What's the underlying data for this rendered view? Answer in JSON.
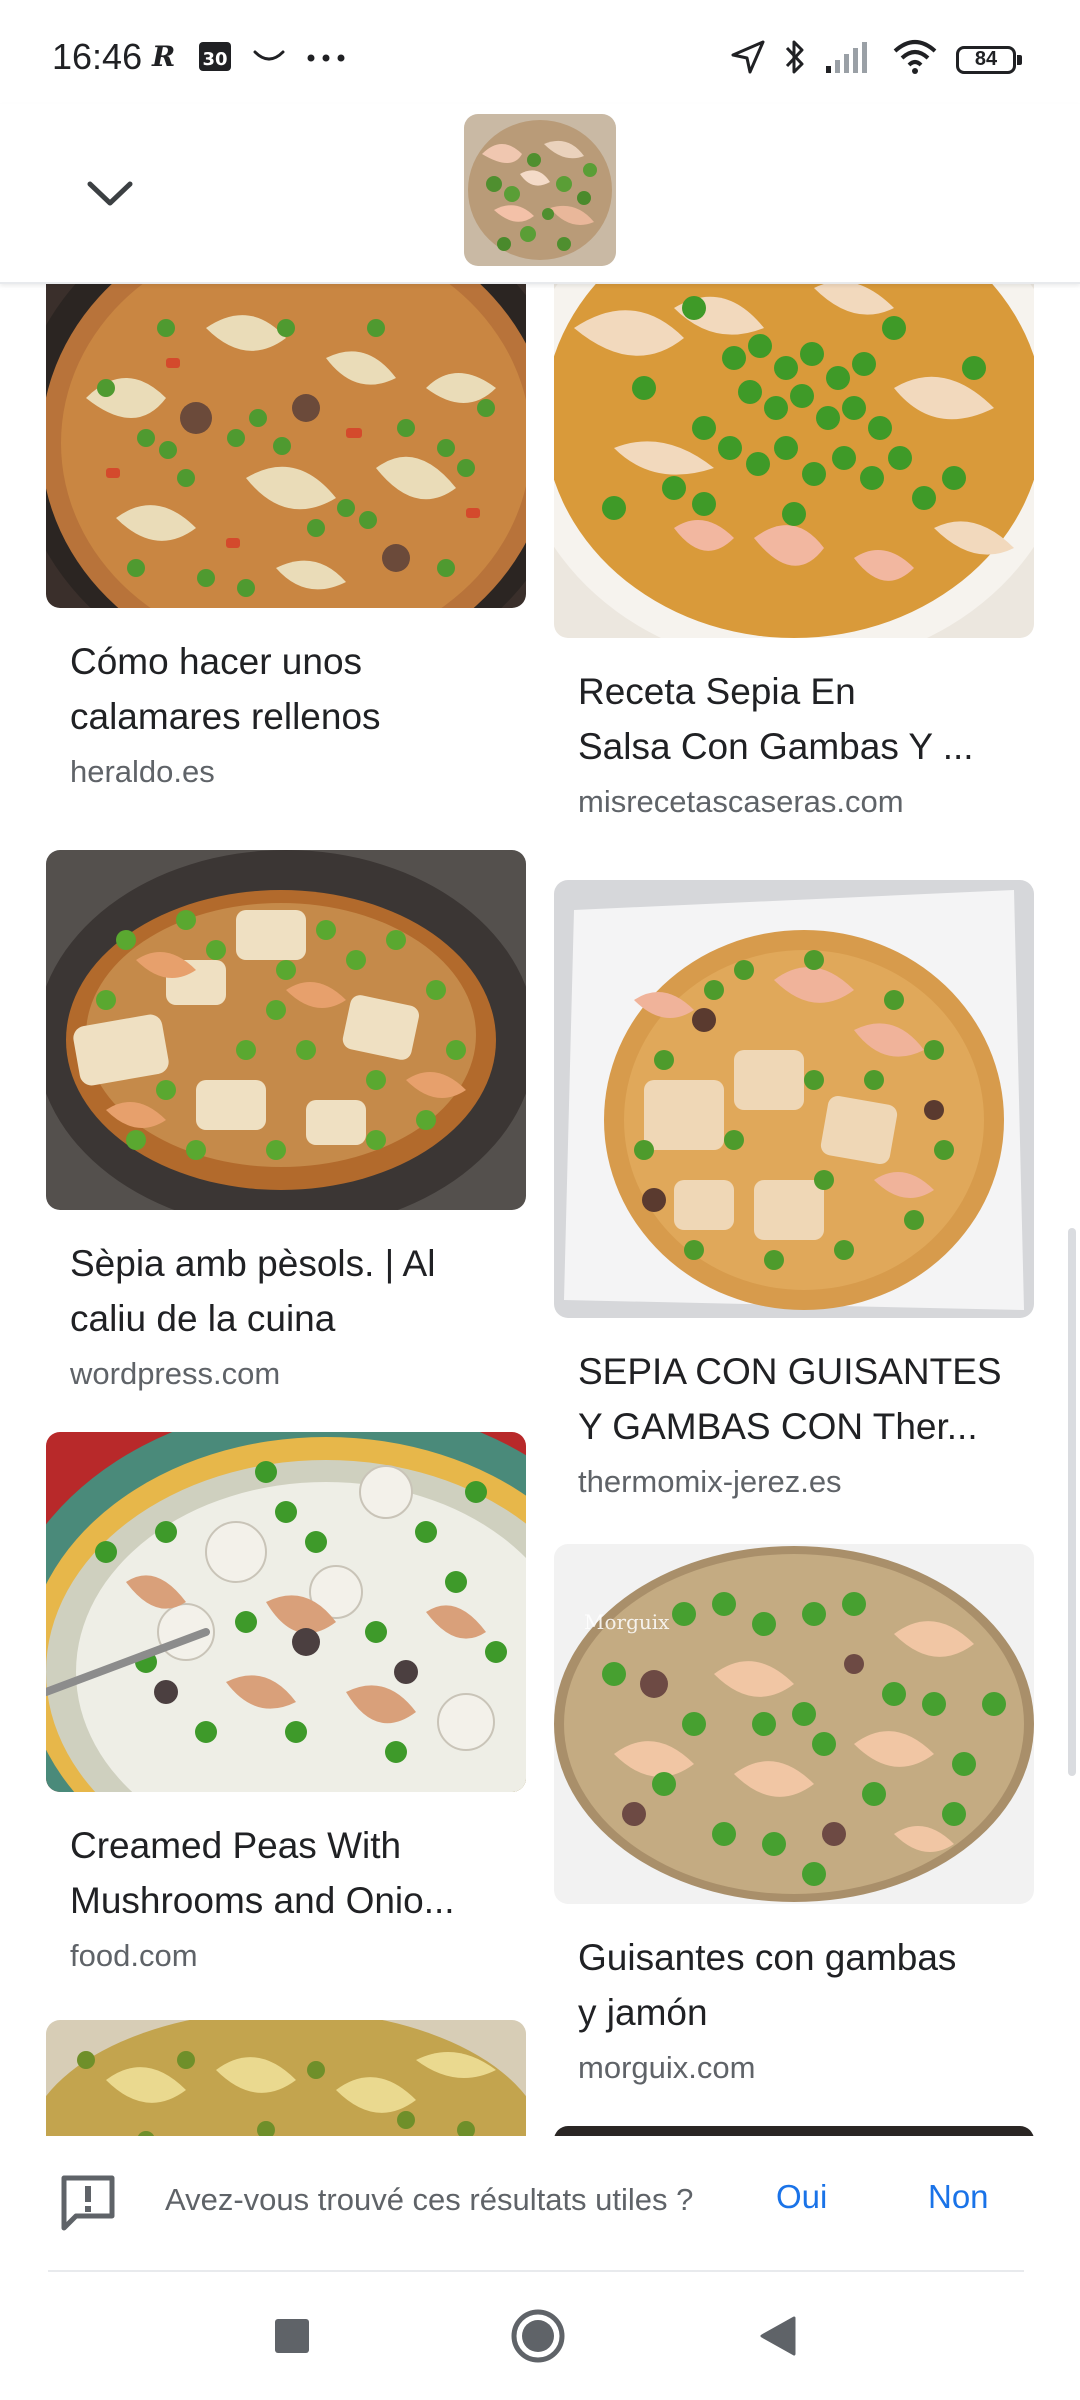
{
  "status_bar": {
    "time": "16:46",
    "battery": "84",
    "left_icons": [
      "r-icon",
      "calendar-30-icon",
      "smile-icon",
      "more-dots-icon"
    ],
    "right_icons": [
      "location-arrow-icon",
      "bluetooth-icon",
      "signal-icon",
      "wifi-icon",
      "battery-icon"
    ]
  },
  "header": {
    "collapse_icon": "chevron-down-icon",
    "thumbnail": "query-image-thumbnail"
  },
  "results": [
    {
      "title_line1": "Cómo hacer unos",
      "title_line2": "calamares rellenos",
      "source": "heraldo.es"
    },
    {
      "title_line1": "Receta Sepia En",
      "title_line2": "Salsa Con Gambas Y ...",
      "source": "misrecetascaseras.com"
    },
    {
      "title_line1": "Sèpia amb pèsols. | Al",
      "title_line2": "caliu de la cuina",
      "source": "wordpress.com"
    },
    {
      "title_line1": "SEPIA CON GUISANTES",
      "title_line2": "Y GAMBAS CON Ther...",
      "source": "thermomix-jerez.es"
    },
    {
      "title_line1": "Creamed Peas With",
      "title_line2": "Mushrooms and Onio...",
      "source": "food.com"
    },
    {
      "title_line1": "Guisantes con gambas",
      "title_line2": "y jamón",
      "source": "morguix.com",
      "watermark": "Morguix"
    }
  ],
  "feedback": {
    "question": "Avez-vous trouvé ces résultats utiles ?",
    "yes": "Oui",
    "no": "Non",
    "icon": "feedback-icon"
  },
  "navbar": {
    "recents": "square-icon",
    "home": "circle-icon",
    "back": "triangle-back-icon"
  },
  "colors": {
    "accent": "#1a73e8",
    "title_text": "#202124",
    "secondary_text": "#5f6368",
    "pea_green": "#3e9a2a",
    "sauce_orange": "#d9902e"
  }
}
